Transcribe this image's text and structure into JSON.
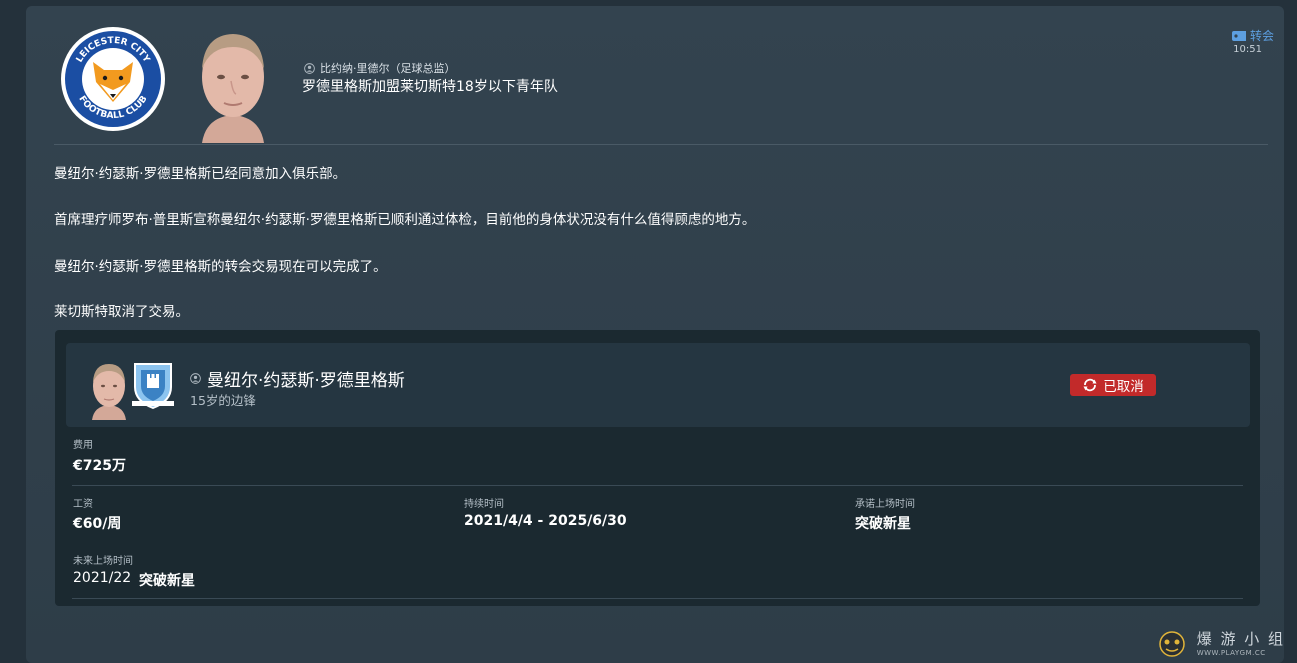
{
  "message": {
    "sender": "比约纳·里德尔（足球总监）",
    "headline": "罗德里格斯加盟莱切斯特18岁以下青年队",
    "tag": "转会",
    "time": "10:51",
    "paragraphs": [
      "曼纽尔·约瑟斯·罗德里格斯已经同意加入俱乐部。",
      "首席理疗师罗布·普里斯宣称曼纽尔·约瑟斯·罗德里格斯已顺利通过体检，目前他的身体状况没有什么值得顾虑的地方。",
      "曼纽尔·约瑟斯·罗德里格斯的转会交易现在可以完成了。",
      "莱切斯特取消了交易。"
    ]
  },
  "club": {
    "logo_text_top": "LEICESTER CITY",
    "logo_text_bottom": "FOOTBALL CLUB",
    "primary_color": "#1b4ea3"
  },
  "card": {
    "player_name": "曼纽尔·约瑟斯·罗德里格斯",
    "player_sub": "15岁的边锋",
    "status": "已取消",
    "status_color": "#c22a2a",
    "fee_label": "费用",
    "fee_value": "€725万",
    "wage_label": "工资",
    "wage_value": "€60/周",
    "duration_label": "持续时间",
    "duration_value": "2021/4/4 - 2025/6/30",
    "promised_label": "承诺上场时间",
    "promised_value": "突破新星",
    "future_label": "未来上场时间",
    "future_season": "2021/22",
    "future_value": "突破新星"
  },
  "watermark": {
    "main": "爆 游 小 组",
    "sub": "WWW.PLAYGM.CC"
  },
  "icons": {
    "person": "person-icon",
    "tag": "transfer-tag-icon",
    "status": "refresh-cancel-icon"
  }
}
